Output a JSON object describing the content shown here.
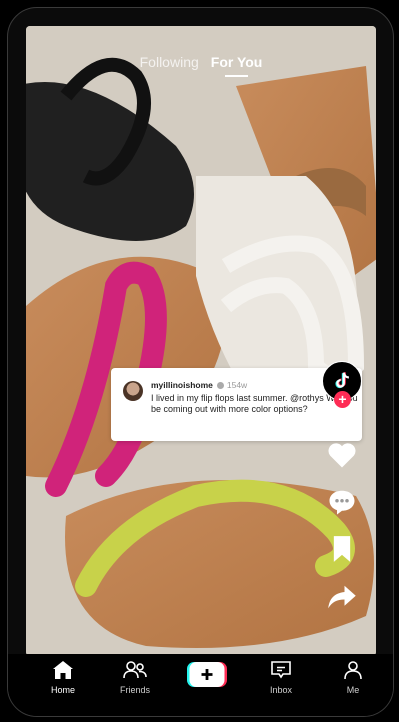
{
  "top_tabs": {
    "following": "Following",
    "for_you": "For You"
  },
  "comment": {
    "username": "myillinoishome",
    "age": "154w",
    "text": "I lived in my flip flops last summer. @rothys Will you be coming out with more color options?"
  },
  "side_actions": [
    "tiktok-logo-icon",
    "heart-icon",
    "comment-icon",
    "bookmark-icon",
    "share-icon"
  ],
  "nav": {
    "home": "Home",
    "friends": "Friends",
    "inbox": "Inbox",
    "me": "Me"
  },
  "colors": {
    "accent_pink": "#fe2c55",
    "accent_cyan": "#25f4ee"
  }
}
